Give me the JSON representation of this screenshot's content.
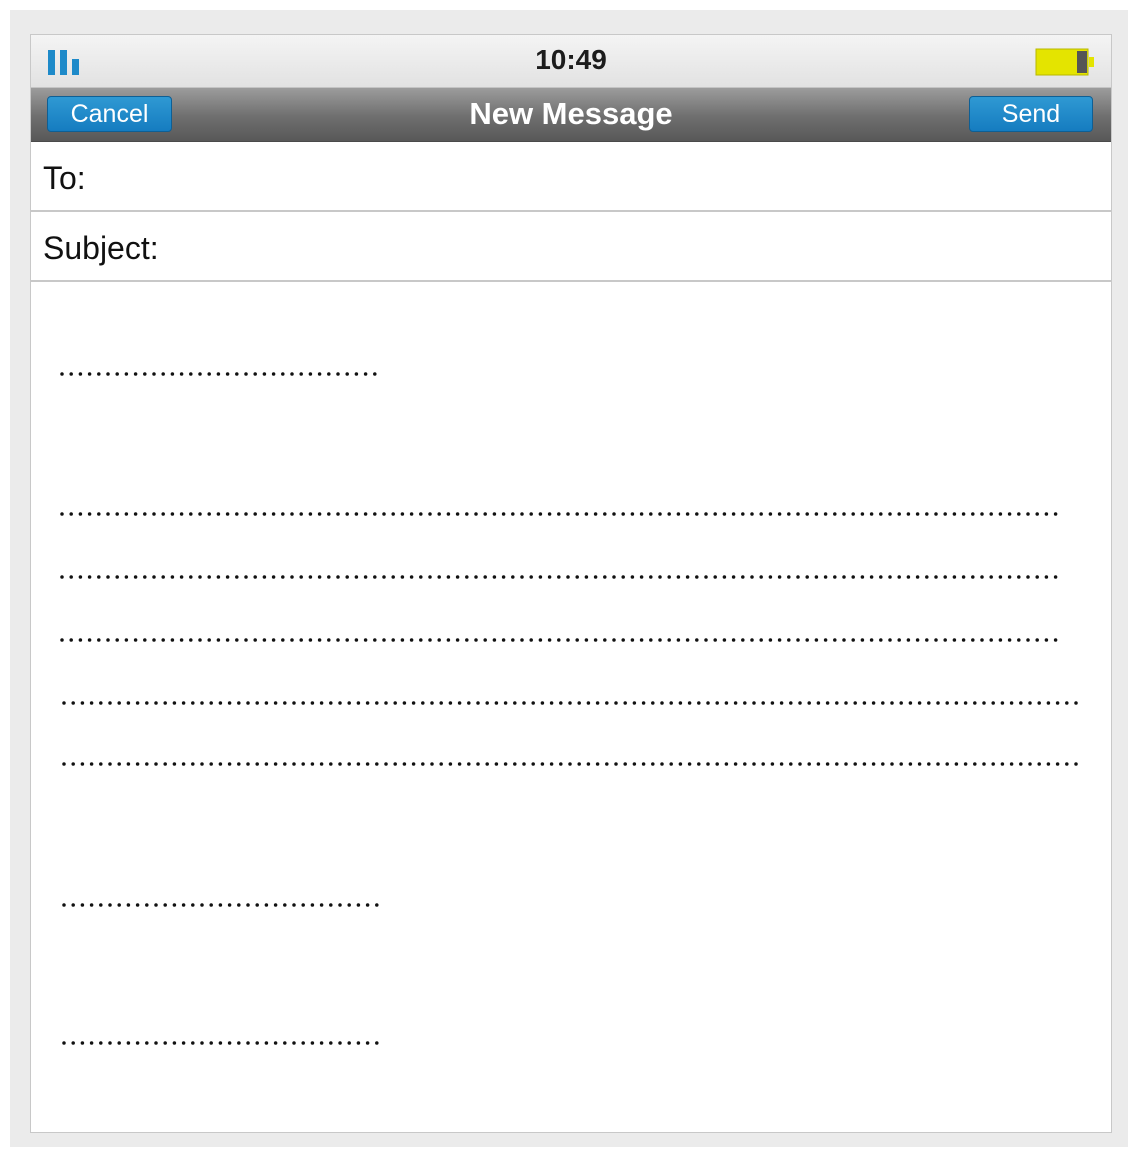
{
  "status_bar": {
    "time": "10:49",
    "signal_icon": "signal-bars-icon",
    "battery_icon": "battery-icon"
  },
  "nav_bar": {
    "cancel_label": "Cancel",
    "title": "New Message",
    "send_label": "Send"
  },
  "compose": {
    "to_label": "To:",
    "subject_label": "Subject:",
    "body_placeholder_lines": 9
  },
  "colors": {
    "accent_button": "#1e88c8",
    "nav_bar": "#6e6e6e",
    "battery_fill": "#e8e600"
  }
}
